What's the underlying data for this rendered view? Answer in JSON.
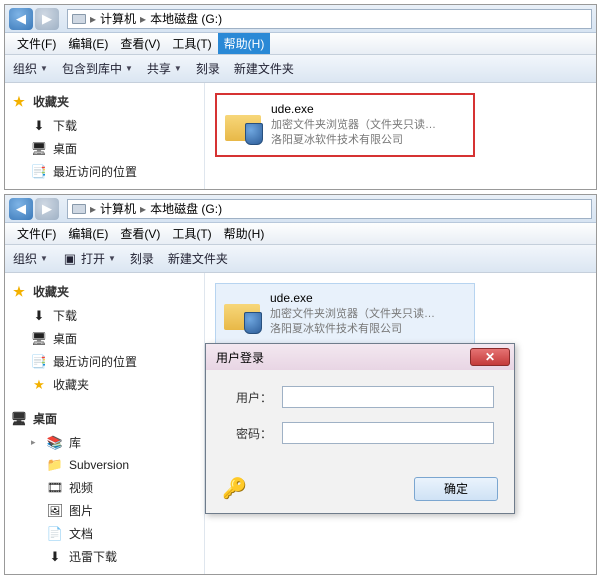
{
  "win1": {
    "breadcrumb": {
      "root": "计算机",
      "drive": "本地磁盘 (G:)"
    },
    "menus": {
      "file": "文件(F)",
      "edit": "编辑(E)",
      "view": "查看(V)",
      "tools": "工具(T)",
      "help": "帮助(H)"
    },
    "toolbar": {
      "organize": "组织",
      "include": "包含到库中",
      "share": "共享",
      "burn": "刻录",
      "newfolder": "新建文件夹"
    },
    "sidebar": {
      "fav": "收藏夹",
      "downloads": "下载",
      "desktop": "桌面",
      "recent": "最近访问的位置"
    },
    "file": {
      "name": "ude.exe",
      "desc": "加密文件夹浏览器（文件夹只读…",
      "company": "洛阳夏冰软件技术有限公司"
    }
  },
  "win2": {
    "breadcrumb": {
      "root": "计算机",
      "drive": "本地磁盘 (G:)"
    },
    "menus": {
      "file": "文件(F)",
      "edit": "编辑(E)",
      "view": "查看(V)",
      "tools": "工具(T)",
      "help": "帮助(H)"
    },
    "toolbar": {
      "organize": "组织",
      "open": "打开",
      "burn": "刻录",
      "newfolder": "新建文件夹"
    },
    "sidebar": {
      "fav": "收藏夹",
      "downloads": "下载",
      "desktop": "桌面",
      "recent": "最近访问的位置",
      "fav2": "收藏夹",
      "desktop2": "桌面",
      "library": "库",
      "subversion": "Subversion",
      "videos": "视频",
      "pictures": "图片",
      "documents": "文档",
      "xunlei": "迅雷下载"
    },
    "file": {
      "name": "ude.exe",
      "desc": "加密文件夹浏览器（文件夹只读…",
      "company": "洛阳夏冰软件技术有限公司"
    },
    "dialog": {
      "title": "用户登录",
      "user": "用户：",
      "pass": "密码：",
      "ok": "确定"
    }
  }
}
